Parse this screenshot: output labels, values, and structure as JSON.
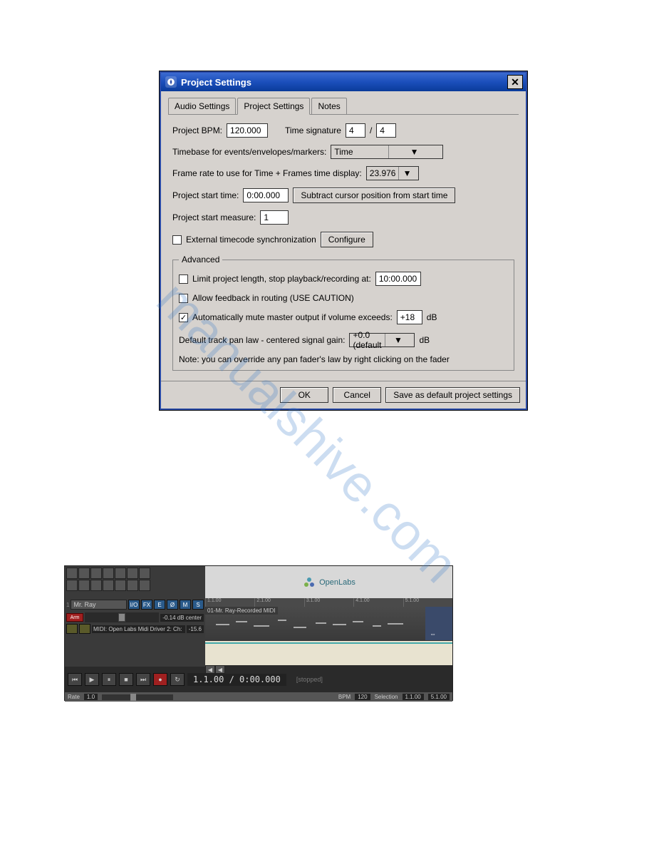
{
  "dialog": {
    "title": "Project Settings",
    "tabs": [
      "Audio Settings",
      "Project Settings",
      "Notes"
    ],
    "active_tab": 1,
    "bpm_label": "Project BPM:",
    "bpm_value": "120.000",
    "tsig_label": "Time signature",
    "tsig_num": "4",
    "tsig_sep": "/",
    "tsig_den": "4",
    "timebase_label": "Timebase for events/envelopes/markers:",
    "timebase_value": "Time",
    "framerate_label": "Frame rate to use for Time + Frames time display:",
    "framerate_value": "23.976",
    "start_time_label": "Project start time:",
    "start_time_value": "0:00.000",
    "subtract_btn": "Subtract cursor position from start time",
    "start_measure_label": "Project start measure:",
    "start_measure_value": "1",
    "ext_tc_label": "External timecode synchronization",
    "configure_btn": "Configure",
    "advanced_legend": "Advanced",
    "limit_label": "Limit project length, stop playback/recording at:",
    "limit_value": "10:00.000",
    "feedback_label": "Allow feedback in routing (USE CAUTION)",
    "automute_label": "Automatically mute master output if volume exceeds:",
    "automute_value": "+18",
    "db_label": "dB",
    "panlaw_label": "Default track pan law - centered signal gain:",
    "panlaw_value": "+0.0 (default",
    "note": "Note: you can override any pan fader's law by right clicking on the fader",
    "ok": "OK",
    "cancel": "Cancel",
    "save_default": "Save as default project settings"
  },
  "daw": {
    "logo": "OpenLabs",
    "track_name": "Mr. Ray",
    "track_btns": [
      "I/O",
      "FX",
      "E",
      "Ø",
      "M",
      "S"
    ],
    "arm": "Arm",
    "pan_read": "-0.14 dB center",
    "midi_src": "MIDI: Open Labs Midi Driver 2: Ch:",
    "midi_num": "-15.6",
    "clip_label": "01-Mr. Ray-Recorded MIDI",
    "ruler": [
      "1.1.00",
      "2.1.00",
      "3.1.00",
      "4.1.00",
      "5.1.00"
    ],
    "time": "1.1.00 / 0:00.000",
    "status": "[stopped]",
    "rate_label": "Rate",
    "rate_value": "1.0",
    "bpm_label": "BPM",
    "bpm_value": "120",
    "sel_label": "Selection",
    "sel_start": "1.1.00",
    "sel_end": "5.1.00"
  },
  "watermark": "manualshive.com"
}
